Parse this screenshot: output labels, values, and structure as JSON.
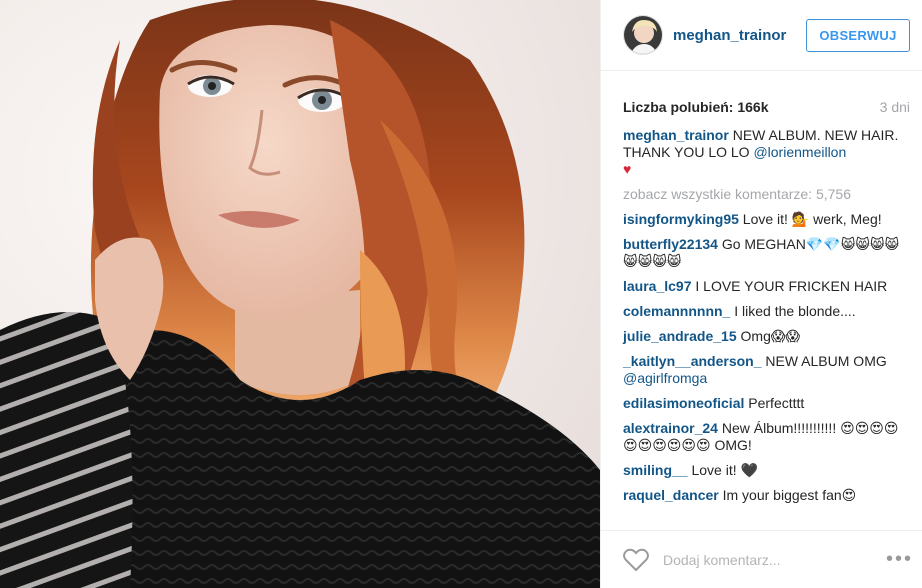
{
  "post": {
    "author": "meghan_trainor",
    "follow_label": "OBSERWUJ",
    "likes_text": "Liczba polubień: 166k",
    "time_text": "3 dni",
    "caption_user": "meghan_trainor",
    "caption_text": " NEW ALBUM. NEW HAIR. THANK YOU LO LO ",
    "caption_mention": "@lorienmeillon",
    "caption_emoji": "♥",
    "view_all": "zobacz wszystkie komentarze: 5,756"
  },
  "comments": [
    {
      "user": "isingformyking95",
      "text": " Love it! 💁 werk, Meg!"
    },
    {
      "user": "butterfly22134",
      "text": " Go MEGHAN💎💎😸😸😸😸😸😸😸😸"
    },
    {
      "user": "laura_lc97",
      "text": " I LOVE YOUR FRICKEN HAIR"
    },
    {
      "user": "colemannnnnn_",
      "text": " I liked the blonde...."
    },
    {
      "user": "julie_andrade_15",
      "text": " Omg😱😱"
    },
    {
      "user": "_kaitlyn__anderson_",
      "text": " NEW ALBUM OMG ",
      "mention": "@agirlfromga"
    },
    {
      "user": "edilasimoneoficial",
      "text": " Perfectttt"
    },
    {
      "user": "alextrainor_24",
      "text": " New Álbum!!!!!!!!!!! 😍😍😍😍😍😍😍😍😍😍 OMG!"
    },
    {
      "user": "smiling__",
      "text": " Love it! 🖤"
    },
    {
      "user": "raquel_dancer",
      "text": " Im your biggest fan😍"
    }
  ],
  "footer": {
    "comment_placeholder": "Dodaj komentarz...",
    "more_label": "•••"
  },
  "colors": {
    "username_blue": "#125688",
    "follow_blue": "#3897f0",
    "muted_gray": "#a5a7aa",
    "heart_red": "#d9263a"
  },
  "icons": [
    "heart-outline-icon",
    "more-options-icon",
    "red-heart-icon"
  ]
}
